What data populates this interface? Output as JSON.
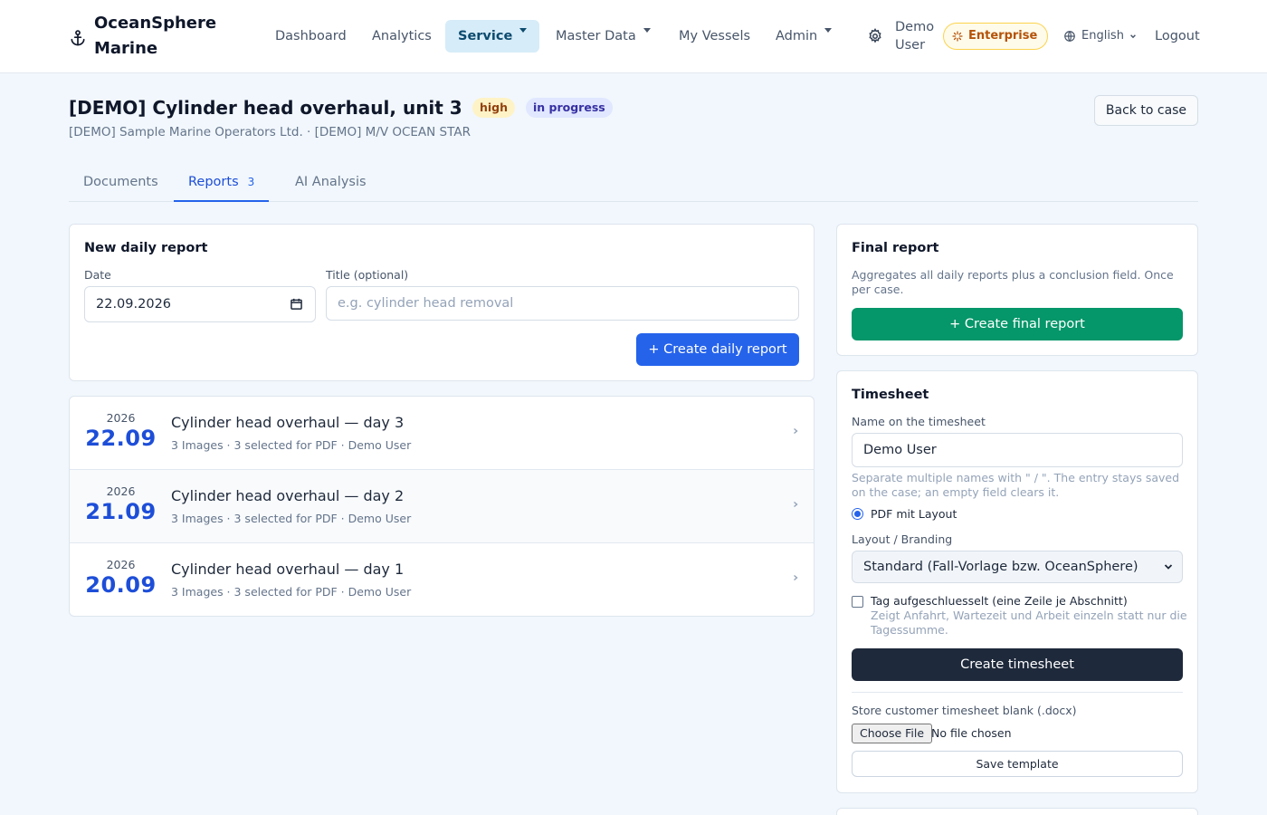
{
  "nav": {
    "brand": "OceanSphere Marine",
    "links": [
      {
        "label": "Dashboard"
      },
      {
        "label": "Analytics"
      },
      {
        "label": "Service"
      },
      {
        "label": "Master Data"
      },
      {
        "label": "My Vessels"
      },
      {
        "label": "Admin"
      }
    ],
    "user": "Demo User",
    "plan": "Enterprise",
    "language": "English",
    "logout": "Logout"
  },
  "case": {
    "title": "[DEMO] Cylinder head overhaul, unit 3",
    "priority": "high",
    "status": "in progress",
    "subtitle": "[DEMO] Sample Marine Operators Ltd. · [DEMO] M/V OCEAN STAR",
    "back_label": "Back to case"
  },
  "tabs": [
    {
      "label": "Documents"
    },
    {
      "label": "Reports",
      "count": "3"
    },
    {
      "label": "AI Analysis"
    }
  ],
  "new_report": {
    "title": "New daily report",
    "date_label": "Date",
    "date_value": "22.09.2026",
    "title_label": "Title (optional)",
    "title_placeholder": "e.g. cylinder head removal",
    "create_label": "+ Create daily report"
  },
  "reports": [
    {
      "year": "2026",
      "day": "22.09",
      "title": "Cylinder head overhaul — day 3",
      "meta": "3 Images · 3 selected for PDF · Demo User"
    },
    {
      "year": "2026",
      "day": "21.09",
      "title": "Cylinder head overhaul — day 2",
      "meta": "3 Images · 3 selected for PDF · Demo User"
    },
    {
      "year": "2026",
      "day": "20.09",
      "title": "Cylinder head overhaul — day 1",
      "meta": "3 Images · 3 selected for PDF · Demo User"
    }
  ],
  "final_report": {
    "title": "Final report",
    "description": "Aggregates all daily reports plus a conclusion field. Once per case.",
    "create_label": "+ Create final report"
  },
  "timesheet": {
    "title": "Timesheet",
    "name_label": "Name on the timesheet",
    "name_value": "Demo User",
    "name_help": "Separate multiple names with \" / \". The entry stays saved on the case; an empty field clears it.",
    "radio_label": "PDF mit Layout",
    "layout_label": "Layout / Branding",
    "layout_value": "Standard (Fall-Vorlage bzw. OceanSphere)",
    "checkbox_label": "Tag aufgeschluesselt (eine Zeile je Abschnitt)",
    "checkbox_help": "Zeigt Anfahrt, Wartezeit und Arbeit einzeln statt nur die Tagessumme.",
    "create_label": "Create timesheet",
    "template_label": "Store customer timesheet blank (.docx)",
    "choose_file": "Choose File",
    "no_file": "No file chosen",
    "save_template": "Save template"
  },
  "colors": {
    "accent": "#2563eb",
    "success": "#059669",
    "dark": "#1e293b",
    "background": "#f1f7fc"
  }
}
